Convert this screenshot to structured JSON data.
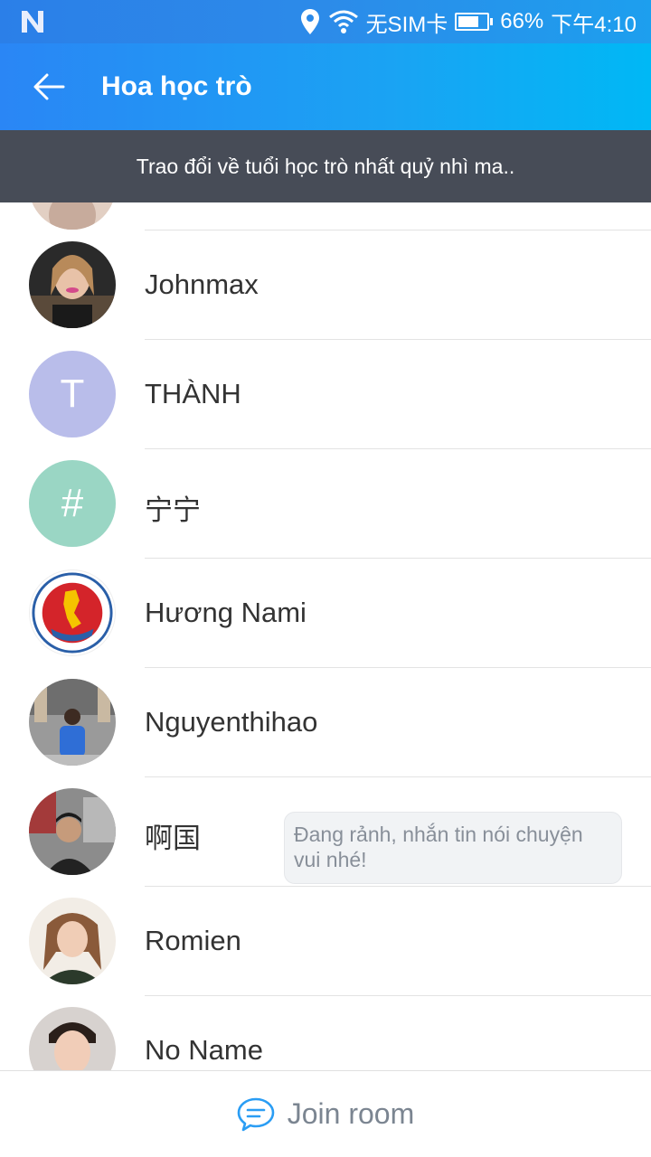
{
  "status_bar": {
    "carrier": "无SIM卡",
    "battery": "66%",
    "time": "下午4:10"
  },
  "appbar": {
    "title": "Hoa học trò"
  },
  "banner": {
    "text": "Trao đổi về tuổi học trò nhất quỷ nhì ma.."
  },
  "members": [
    {
      "name": "Johnmax"
    },
    {
      "name": "THÀNH",
      "initial": "T"
    },
    {
      "name": "宁宁",
      "initial": "#"
    },
    {
      "name": "Hương Nami"
    },
    {
      "name": "Nguyenthihao"
    },
    {
      "name": "啊国"
    },
    {
      "name": "Romien"
    },
    {
      "name": "No Name",
      "status": "Đang rảnh, nhắn tin nói chuyện vui nhé!"
    }
  ],
  "bottom": {
    "join_label": "Join room"
  },
  "colors": {
    "accent": "#2a86f5",
    "banner_bg": "#474c57",
    "avatar_T": "#b9bdea",
    "avatar_hash": "#9ad6c4"
  }
}
